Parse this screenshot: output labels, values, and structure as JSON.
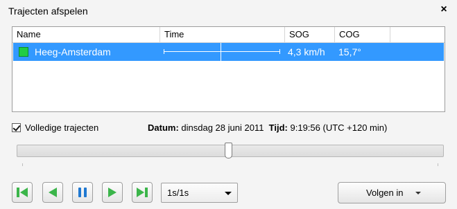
{
  "window": {
    "title": "Trajecten afspelen",
    "close_symbol": "×"
  },
  "table": {
    "columns": [
      "Name",
      "Time",
      "SOG",
      "COG"
    ],
    "rows": [
      {
        "name": "Heeg-Amsterdam",
        "sog": "4,3 km/h",
        "cog": "15,7°",
        "color": "#22cc44",
        "selected": true
      }
    ]
  },
  "options": {
    "full_tracks_label": "Volledige trajecten",
    "full_tracks_checked": true
  },
  "status": {
    "datum_label": "Datum:",
    "datum_value": "dinsdag 28 juni 2011",
    "tijd_label": "Tijd:",
    "tijd_value": "9:19:56 (UTC +120 min)"
  },
  "playback": {
    "position_fraction": 0.49,
    "speed": "1s/1s",
    "follow_label": "Volgen in"
  },
  "colors": {
    "selection": "#3399ff",
    "button_icon_green": "#3bb54a",
    "button_icon_blue": "#1f78d1"
  }
}
